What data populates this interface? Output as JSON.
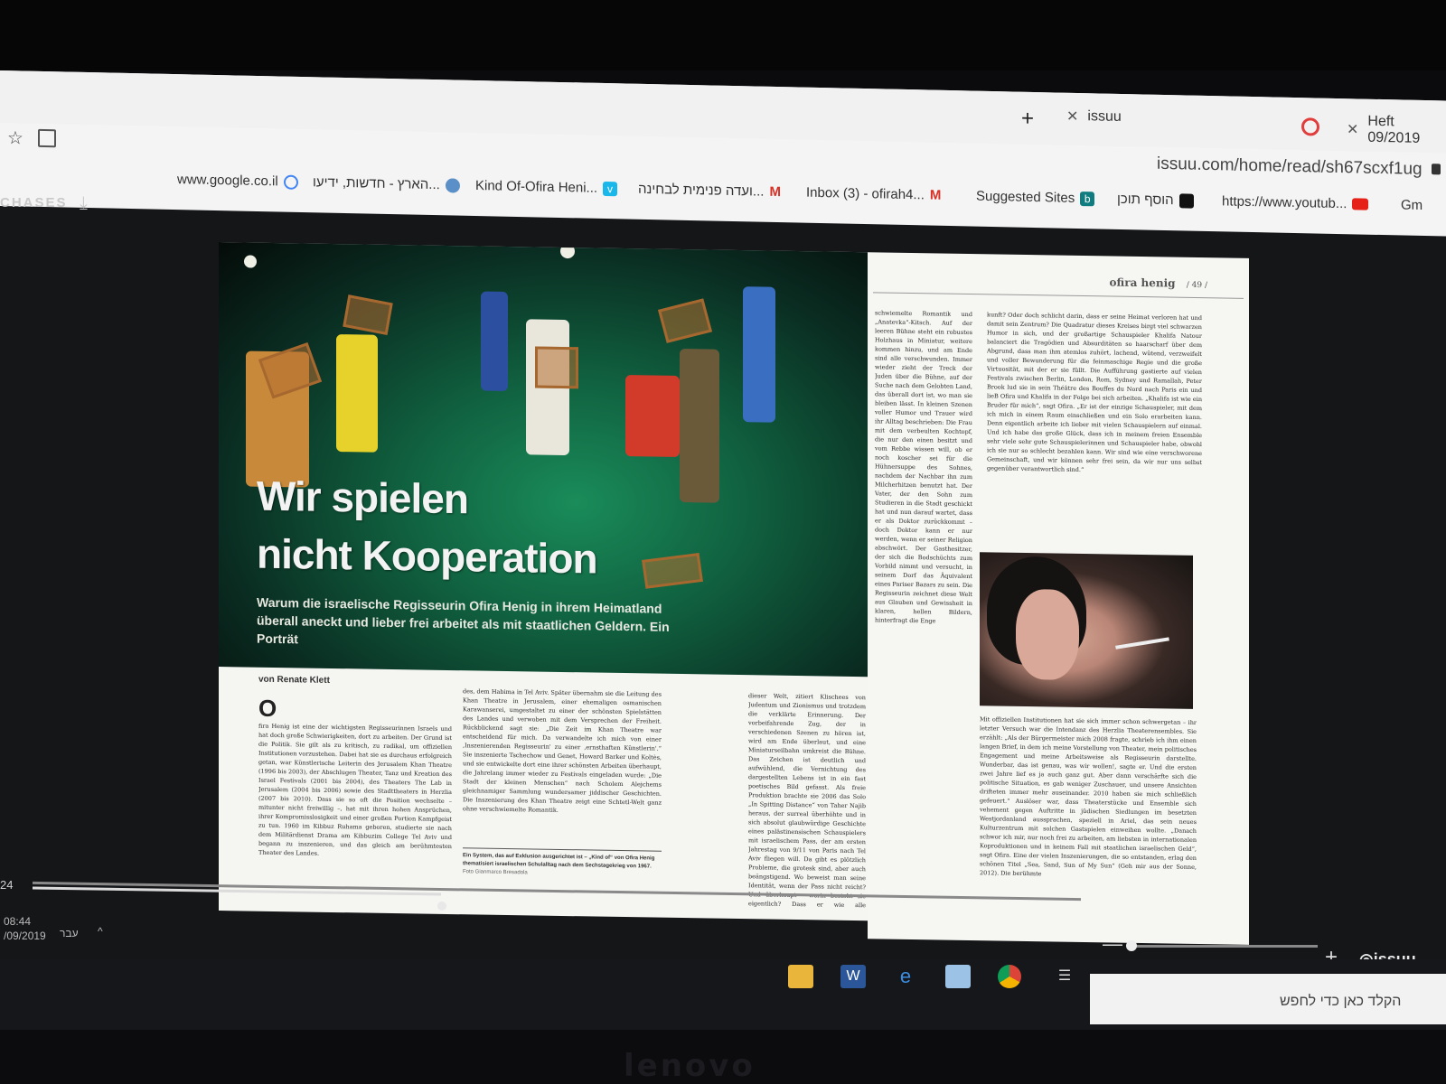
{
  "browser": {
    "tabs": [
      {
        "label": "issuu"
      },
      {
        "label": "Heft 09/2019"
      }
    ],
    "url": "issuu.com/home/read/sh67scxf1ug",
    "bookmarks": [
      {
        "label": "www.google.co.il",
        "icon": "google-icon"
      },
      {
        "label": "הארץ - חדשות, ידיעו...",
        "icon": "haaretz-icon"
      },
      {
        "label": "Kind Of-Ofira Heni...",
        "icon": "vimeo-icon"
      },
      {
        "label": "ועדה פנימית לבחינה...",
        "icon": "gmail-icon"
      },
      {
        "label": "Inbox (3) - ofirah4...",
        "icon": "gmail-icon"
      },
      {
        "label": "Suggested Sites",
        "icon": "bing-icon"
      },
      {
        "label": "הוסף תוכן",
        "icon": "bookmark-icon"
      },
      {
        "label": "https://www.youtub...",
        "icon": "youtube-icon"
      },
      {
        "label": "Gm",
        "icon": "gmail-icon"
      }
    ]
  },
  "toolbar": {
    "purchases": "CHASES"
  },
  "article": {
    "title_line1": "Wir spielen",
    "title_line2": "nicht Kooperation",
    "subtitle": "Warum die israelische Regisseurin Ofira Henig in ihrem Heimatland überall aneckt und lieber frei arbeitet als mit staatlichen Geldern. Ein Porträt",
    "byline": "von Renate Klett",
    "dropcap": "O",
    "running_head": "ofira henig",
    "page_ref": "/ 49 /",
    "col1": "fira Henig ist eine der wichtigsten Regisseurinnen Israels und hat doch große Schwierigkeiten, dort zu arbeiten. Der Grund ist die Politik. Sie gilt als zu kritisch, zu radikal, um offiziellen Institutionen vorzustehen. Dabei hat sie es durchaus erfolgreich getan, war Künstlerische Leiterin des Jerusalem Khan Theatre (1996 bis 2003), der Abschlugen Theater, Tanz und Kreation des Israel Festivals (2001 bis 2004), des Theaters The Lab in Jerusalem (2004 bis 2006) sowie des Stadttheaters in Herzlia (2007 bis 2010). Dass sie so oft die Position wechselte – mitunter nicht freiwillig –, hat mit ihren hohen Ansprüchen, ihrer Kompromisslosigkeit und einer großen Portion Kampfgeist zu tun. 1960 im Kibbuz Ruhama geboren, studierte sie nach dem Militärdienst Drama am Kibbuzim College Tel Aviv und begann zu inszenieren, und das gleich am berühmtesten Theater des Landes.",
    "col2": "des, dem Habima in Tel Aviv. Später übernahm sie die Leitung des Khan Theatre in Jerusalem, einer ehemaligen osmanischen Karawanserei, umgestaltet zu einer der schönsten Spielstätten des Landes und verwoben mit dem Versprechen der Freiheit. Rückblickend sagt sie: „Die Zeit im Khan Theatre war entscheidend für mich. Da verwandelte ich mich von einer ‚Inszenierenden Regisseurin' zu einer ‚ernsthaften Künstlerin'.“ Sie inszenierte Tschechow und Genet, Howard Barker und Koltès, und sie entwickelte dort eine ihrer schönsten Arbeiten überhaupt, die Jahrelang immer wieder zu Festivals eingeladen wurde: „Die Stadt der kleinen Menschen“ nach Scholem Alejchems gleichnamiger Sammlung wundersamer jiddischer Geschichten. Die Inszenierung des Khan Theatre zeigt eine Schtetl-Welt ganz ohne verschwiemelte Romantik.",
    "caption": "Ein System, das auf Exklusion ausgerichtet ist – „Kind of“ von Ofira Henig thematisiert israelischen Schulalltag nach dem Sechstagekrieg von 1967.",
    "caption_credit": "Foto Gianmarco Bresadola",
    "col3": "schwiemelte Romantik und „Anatevka“-Kitsch. Auf der leeren Bühne steht ein robustes Holzhaus in Miniatur, weitere kommen hinzu, und am Ende sind alle verschwunden. Immer wieder zieht der Treck der Juden über die Bühne, auf der Suche nach dem Gelobten Land, das überall dort ist, wo man sie bleiben lässt. In kleinen Szenen voller Humor und Trauer wird ihr Alltag beschrieben: Die Frau mit dem verbeulten Kochtopf, die nur den einen besitzt und vom Rebbe wissen will, ob er noch koscher sei für die Hühnersuppe des Sohnes, nachdem der Nachbar ihn zum Milcherhitzen benutzt hat. Der Vater, der den Sohn zum Studieren in die Stadt geschickt hat und nun darauf wartet, dass er als Doktor zurückkommt – doch Doktor kann er nur werden, wenn er seiner Religion abschwört. Der Gasthesitzer, der sich die Bodschüchts zum Vorbild nimmt und versucht, in seinem Dorf das Äquivalent eines Pariser Bazars zu sein. Die Regisseurin zeichnet diese Welt aus Glauben und Gewissheit in klaren, hellen Bildern, hinterfragt die Enge",
    "col4": "kunft? Oder doch schlicht darin, dass er seine Heimat verloren hat und damit sein Zentrum? Die Quadratur dieses Kreises birgt viel schwarzen Humor in sich, und der großartige Schauspieler Khalifa Natour balanciert die Tragödien und Absurditäten so haarscharf über dem Abgrund, dass man ihm atemlos zuhört, lachend, wütend, verzweifelt und voller Bewunderung für die feinmaschige Regie und die große Virtuosität, mit der er sie füllt. Die Aufführung gastierte auf vielen Festivals zwischen Berlin, London, Rom, Sydney und Ramallah, Peter Brook lud sie in sein Théâtre des Bouffes du Nord nach Paris ein und lieB Ofira und Khalifa in der Folge bei sich arbeiten. „Khalifa ist wie ein Bruder für mich“, sagt Ofira. „Er ist der einzige Schauspieler, mit dem ich mich in einem Raum einschließen und ein Solo erarbeiten kann. Denn eigentlich arbeite ich lieber mit vielen Schauspielern auf einmal. Und ich habe das große Glück, dass ich in meinem freien Ensemble sehr viele sehr gute Schauspielerinnen und Schauspieler habe, obwohl ich sie nur so schlecht bezahlen kann. Wir sind wie eine verschworene Gemeinschaft, und wir können sehr frei sein, da wir nur uns selbst gegenüber verantwortlich sind.“",
    "col5": "dieser Welt, zitiert Klischees von Judentum und Zionismus und trotzdem die verklärte Erinnerung. Der vorbeifahrende Zug, der in verschiedenen Szenen zu hören ist, wird am Ende überlaut, und eine Miniaturseilbahn umkreist die Bühne. Das Zeichen ist deutlich und aufwühlend, die Vernichtung des dargestellten Lebens ist in ein fast poetisches Bild gefasst. Als freie Produktion brachte sie 2006 das Solo „In Spitting Distance“ von Taher Najib heraus, der surreal überhöhte und in sich absolut glaubwürdige Geschichte eines palästinensischen Schauspielers mit israelischem Pass, der am ersten Jahrestag von 9/11 von Paris nach Tel Aviv fliegen will. Da gibt es plötzlich Probleme, die grotesk sind, aber auch beängstigend. Wo beweist man seine Identität, wenn der Pass nicht reicht? Und überhaupt – worin besteht sie eigentlich? Dass er wie alle Palästinenser in Ramallah immer ausspuckt, als könnte man damit den schlechten Geschmack im Mund loswerden, den die Besatzung verursacht? Dass er als Schauspieler ein und dieselbe Szene auf Arabisch und auf Hebräisch spielen kann? Dass die französische Polizei ihn beim Abflug genauso lange verhört wie die israelische bei der An-",
    "col6": "Mit offiziellen Institutionen hat sie sich immer schon schwergetan – ihr letzter Versuch war die Intendanz des Herzlia Theaterensembles. Sie erzählt: „Als der Bürgermeister mich 2008 fragte, schrieb ich ihm einen langen Brief, in dem ich meine Vorstellung von Theater, mein politisches Engagement und meine Arbeitsweise als Regisseurin darstellte. Wunderbar, das ist genau, was wir wollen!, sagte er. Und die ersten zwei Jahre lief es ja auch ganz gut. Aber dann verschärfte sich die politische Situation, es gab weniger Zuschauer, und unsere Ansichten drifteten immer mehr auseinander. 2010 haben sie mich schließlich gefeuert.“ Auslöser war, dass Theaterstücke und Ensemble sich vehement gegen Auftritte in jüdischen Siedlungen im besetzten Westjordanland aussprachen, speziell in Ariel, das sein neues Kulturzentrum mit solchen Gastspielen einweihen wollte. „Danach schwor ich mir, nur noch frei zu arbeiten, am liebsten in internationalen Koproduktionen und in keinem Fall mit staatlichen israelischen Geld“, sagt Ofira. Eine der vielen Inszenierungen, die so entstanden, erlag den schönen Titel „Sea, Sand, Sun of My Sun“ (Geh mir aus der Sonne, 2012). Die berühmte"
  },
  "viewer": {
    "page_indicator": "24",
    "progress": 0.39,
    "zoom_level": 0.02
  },
  "taskbar": {
    "time": "08:44",
    "date": "/09/2019",
    "language": "עבר",
    "search_placeholder": "הקלד כאן כדי לחפש",
    "apps": [
      "file-explorer-icon",
      "word-icon",
      "edge-icon",
      "media-icon",
      "chrome-icon",
      "task-view-icon"
    ]
  },
  "device": {
    "brand": "lenovo"
  },
  "colors": {
    "stage_green": "#10603f",
    "page_bg": "#f5f5f2",
    "taskbar": "#16171b",
    "bookmark_red": "#d93025"
  }
}
